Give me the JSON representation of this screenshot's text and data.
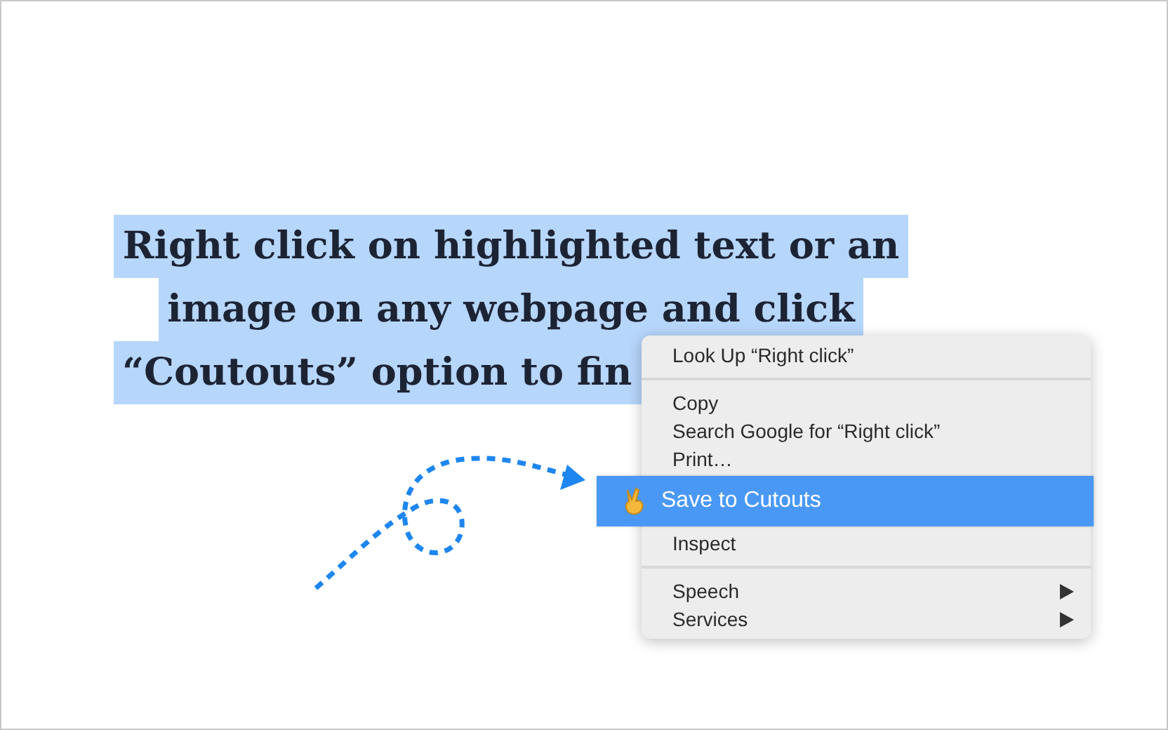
{
  "headline": {
    "lines": [
      "Right click on highlighted text or an",
      "image on any webpage and click",
      "“Coutouts” option to fin"
    ],
    "highlighted": true
  },
  "context_menu": {
    "items": [
      {
        "kind": "item",
        "label": "Look Up “Right click”",
        "selected": false,
        "submenu": false
      },
      {
        "kind": "separator"
      },
      {
        "kind": "item",
        "label": "Copy",
        "selected": false,
        "submenu": false
      },
      {
        "kind": "item",
        "label": "Search Google for “Right click”",
        "selected": false,
        "submenu": false
      },
      {
        "kind": "item",
        "label": "Print…",
        "selected": false,
        "submenu": false
      },
      {
        "kind": "item",
        "label": "Save to Cutouts",
        "selected": true,
        "submenu": false,
        "icon": true
      },
      {
        "kind": "item",
        "label": "Inspect",
        "selected": false,
        "submenu": false
      },
      {
        "kind": "separator"
      },
      {
        "kind": "item",
        "label": "Speech",
        "selected": false,
        "submenu": true
      },
      {
        "kind": "item",
        "label": "Services",
        "selected": false,
        "submenu": true
      }
    ]
  }
}
